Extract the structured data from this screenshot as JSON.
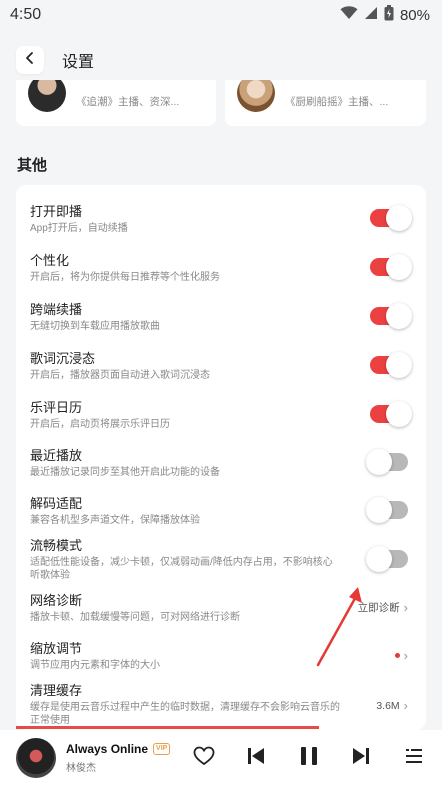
{
  "status_bar": {
    "time": "4:50",
    "battery": "80%"
  },
  "header": {
    "title": "设置"
  },
  "top_cards": [
    {
      "desc": "《追潮》主播、资深..."
    },
    {
      "desc": "《厨刷船摇》主播、..."
    }
  ],
  "section": {
    "title": "其他"
  },
  "settings": [
    {
      "title": "打开即播",
      "sub": "App打开后，自动续播",
      "state": "on"
    },
    {
      "title": "个性化",
      "sub": "开启后，将为你提供每日推荐等个性化服务",
      "state": "on"
    },
    {
      "title": "跨端续播",
      "sub": "无缝切换到车载应用播放歌曲",
      "state": "on"
    },
    {
      "title": "歌词沉浸态",
      "sub": "开启后，播放器页面自动进入歌词沉浸态",
      "state": "on"
    },
    {
      "title": "乐评日历",
      "sub": "开启后，启动页将展示乐评日历",
      "state": "on"
    },
    {
      "title": "最近播放",
      "sub": "最近播放记录同步至其他开启此功能的设备",
      "state": "off"
    },
    {
      "title": "解码适配",
      "sub": "兼容各机型多声道文件，保障播放体验",
      "state": "off"
    },
    {
      "title": "流畅模式",
      "sub": "适配低性能设备，减少卡顿，仅减弱动画/降低内存占用，不影响核心听歌体验",
      "state": "off"
    },
    {
      "title": "网络诊断",
      "sub": "播放卡顿、加载缓慢等问题，可对网络进行诊断",
      "value": "立即诊断"
    },
    {
      "title": "缩放调节",
      "sub": "调节应用内元素和字体的大小",
      "value": ""
    },
    {
      "title": "清理缓存",
      "sub": "缓存是使用云音乐过程中产生的临时数据，清理缓存不会影响云音乐的正常使用",
      "value": "3.6M"
    }
  ],
  "player": {
    "title": "Always Online",
    "badge": "VIP",
    "artist": "林俊杰",
    "progress": 0.74
  },
  "colors": {
    "accent": "#eb4141",
    "toggle_off": "#b8b8b8",
    "background": "#f4f5f7"
  },
  "icons": [
    "back-icon",
    "wifi-icon",
    "signal-icon",
    "battery-icon",
    "heart-icon",
    "previous-icon",
    "pause-icon",
    "next-icon",
    "playlist-icon"
  ]
}
